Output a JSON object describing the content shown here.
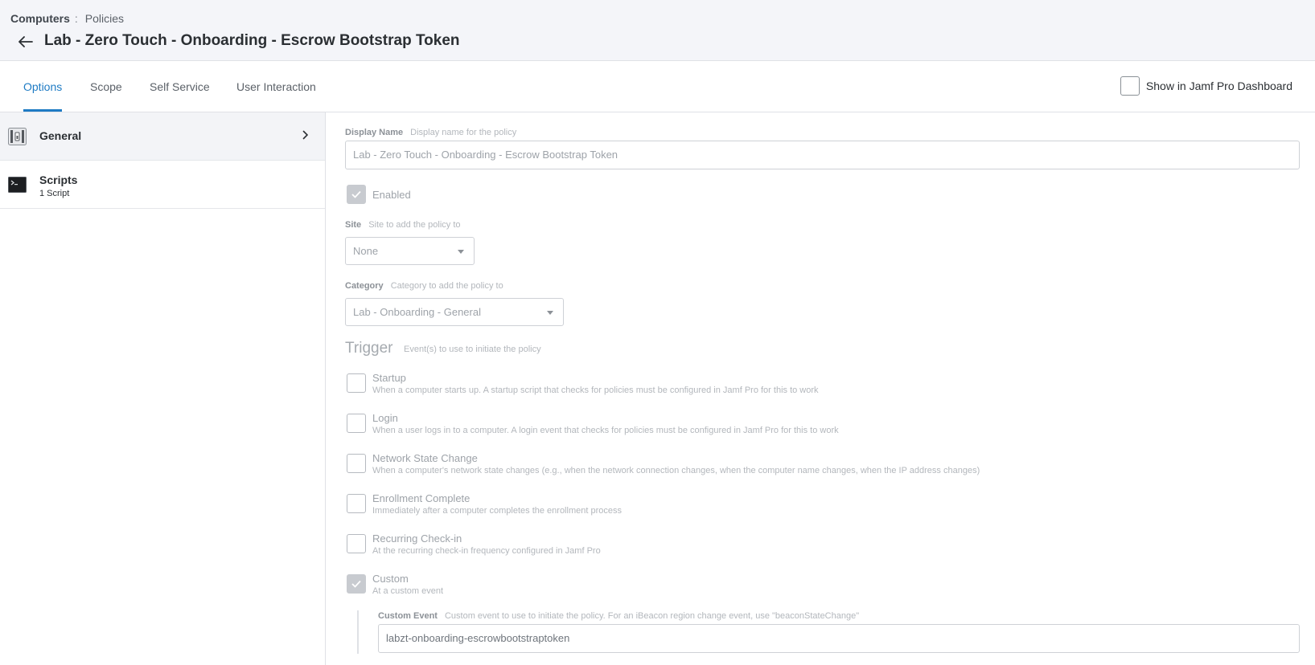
{
  "breadcrumb": {
    "root": "Computers",
    "separator": ":",
    "current": "Policies"
  },
  "header": {
    "title": "Lab - Zero Touch - Onboarding - Escrow Bootstrap Token"
  },
  "tabs": [
    {
      "label": "Options",
      "active": true
    },
    {
      "label": "Scope",
      "active": false
    },
    {
      "label": "Self Service",
      "active": false
    },
    {
      "label": "User Interaction",
      "active": false
    }
  ],
  "dashboard_toggle": {
    "label": "Show in Jamf Pro Dashboard",
    "checked": false
  },
  "sidebar": {
    "items": [
      {
        "title": "General",
        "subtitle": "",
        "icon": "general-settings-icon",
        "active": true
      },
      {
        "title": "Scripts",
        "subtitle": "1 Script",
        "icon": "terminal-icon",
        "active": false
      }
    ]
  },
  "form": {
    "display_name": {
      "label": "Display Name",
      "hint": "Display name for the policy",
      "value": "Lab - Zero Touch - Onboarding - Escrow Bootstrap Token"
    },
    "enabled": {
      "label": "Enabled",
      "checked": true
    },
    "site": {
      "label": "Site",
      "hint": "Site to add the policy to",
      "value": "None"
    },
    "category": {
      "label": "Category",
      "hint": "Category to add the policy to",
      "value": "Lab - Onboarding - General"
    },
    "trigger": {
      "title": "Trigger",
      "hint": "Event(s) to use to initiate the policy",
      "options": [
        {
          "label": "Startup",
          "desc": "When a computer starts up. A startup script that checks for policies must be configured in Jamf Pro for this to work",
          "checked": false
        },
        {
          "label": "Login",
          "desc": "When a user logs in to a computer. A login event that checks for policies must be configured in Jamf Pro for this to work",
          "checked": false
        },
        {
          "label": "Network State Change",
          "desc": "When a computer's network state changes (e.g., when the network connection changes, when the computer name changes, when the IP address changes)",
          "checked": false
        },
        {
          "label": "Enrollment Complete",
          "desc": "Immediately after a computer completes the enrollment process",
          "checked": false
        },
        {
          "label": "Recurring Check-in",
          "desc": "At the recurring check-in frequency configured in Jamf Pro",
          "checked": false
        },
        {
          "label": "Custom",
          "desc": "At a custom event",
          "checked": true
        }
      ]
    },
    "custom_event": {
      "label": "Custom Event",
      "hint": "Custom event to use to initiate the policy. For an iBeacon region change event, use \"beaconStateChange\"",
      "value": "labzt-onboarding-escrowbootstraptoken"
    }
  },
  "colors": {
    "accent": "#1e7bc4",
    "header_bg": "#f4f5f9",
    "disabled_text": "#9ea3a9"
  }
}
